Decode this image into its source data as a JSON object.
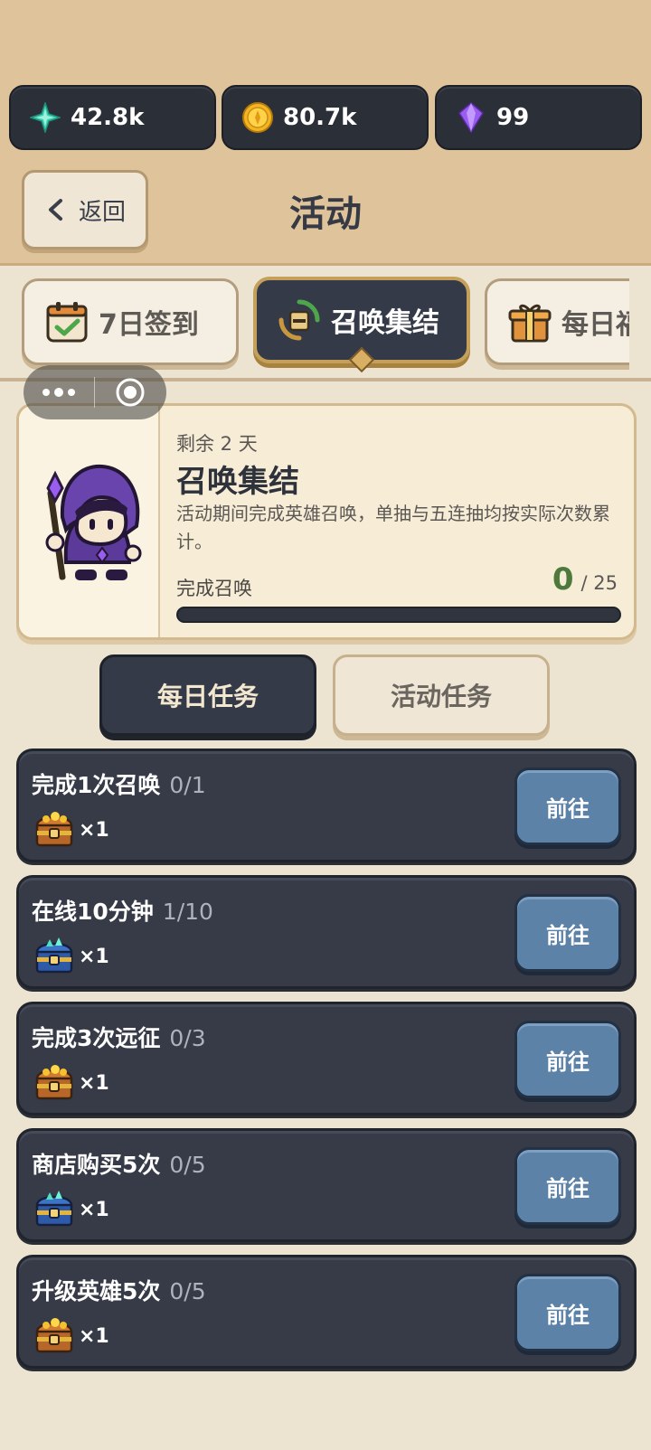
{
  "currencies": [
    {
      "name": "gem-green",
      "value": "42.8k",
      "icon": "star-crystal-icon",
      "color": "#3fd1b0"
    },
    {
      "name": "gold",
      "value": "80.7k",
      "icon": "gold-coin-icon",
      "color": "#f4b522"
    },
    {
      "name": "diamond",
      "value": "99",
      "icon": "purple-diamond-icon",
      "color": "#9b5cf0"
    }
  ],
  "header": {
    "back_label": "返回",
    "title": "活动"
  },
  "tabs": [
    {
      "label": "7日签到",
      "icon": "calendar-check-icon",
      "active": false
    },
    {
      "label": "召唤集结",
      "icon": "summon-scroll-icon",
      "active": true
    },
    {
      "label": "每日福",
      "icon": "gift-box-icon",
      "active": false
    }
  ],
  "event": {
    "remaining": "剩余 2 天",
    "name": "召唤集结",
    "description": "活动期间完成英雄召唤，单抽与五连抽均按实际次数累计。",
    "progress_label": "完成召唤",
    "progress_current": "0",
    "progress_total": "/ 25",
    "progress_fraction": 0
  },
  "subtabs": {
    "daily": "每日任务",
    "event": "活动任务"
  },
  "tasks": [
    {
      "name": "完成1次召唤",
      "progress": "0/1",
      "reward_icon": "gold-chest-icon",
      "reward_count": "×1",
      "button": "前往"
    },
    {
      "name": "在线10分钟",
      "progress": "1/10",
      "reward_icon": "blue-chest-icon",
      "reward_count": "×1",
      "button": "前往"
    },
    {
      "name": "完成3次远征",
      "progress": "0/3",
      "reward_icon": "gold-chest-icon",
      "reward_count": "×1",
      "button": "前往"
    },
    {
      "name": "商店购买5次",
      "progress": "0/5",
      "reward_icon": "blue-chest-icon",
      "reward_count": "×1",
      "button": "前往"
    },
    {
      "name": "升级英雄5次",
      "progress": "0/5",
      "reward_icon": "gold-chest-icon",
      "reward_count": "×1",
      "button": "前往"
    }
  ]
}
